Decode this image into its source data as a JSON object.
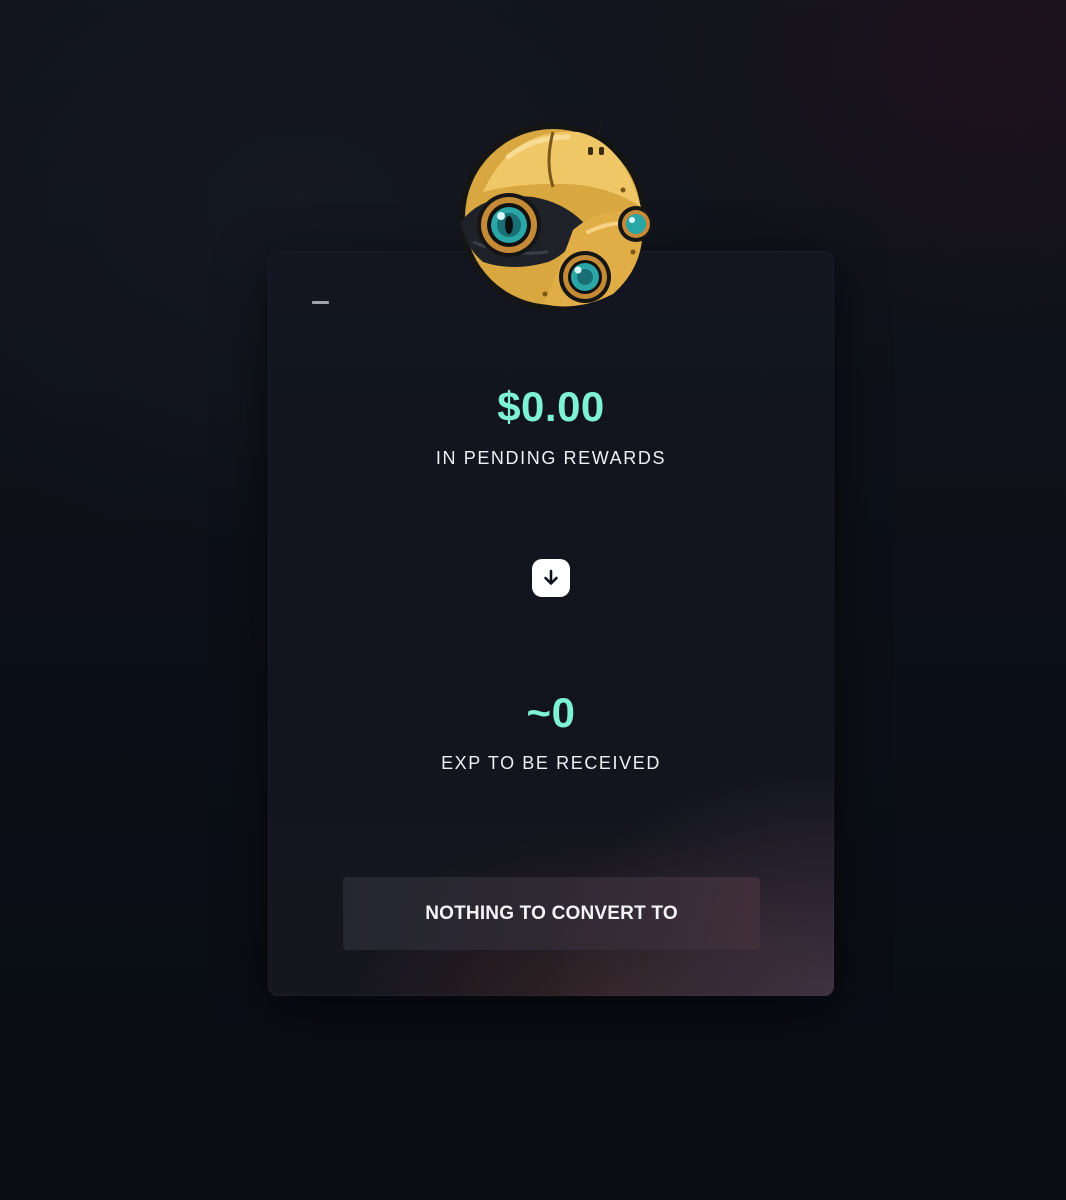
{
  "card": {
    "rewards_amount": "$0.00",
    "rewards_caption": "IN PENDING REWARDS",
    "exp_amount": "~0",
    "exp_caption": "EXP TO BE RECEIVED",
    "convert_button_label": "NOTHING TO CONVERT TO"
  },
  "icons": {
    "minimize": "minimize-icon",
    "swap": "arrow-down-icon",
    "avatar": "robot-head-mascot"
  },
  "colors": {
    "accent": "#7ff2d6",
    "background": "#0d1018",
    "card": "#12151e",
    "mascot_gold": "#e3b24a",
    "mascot_eye": "#2aa6a6"
  }
}
